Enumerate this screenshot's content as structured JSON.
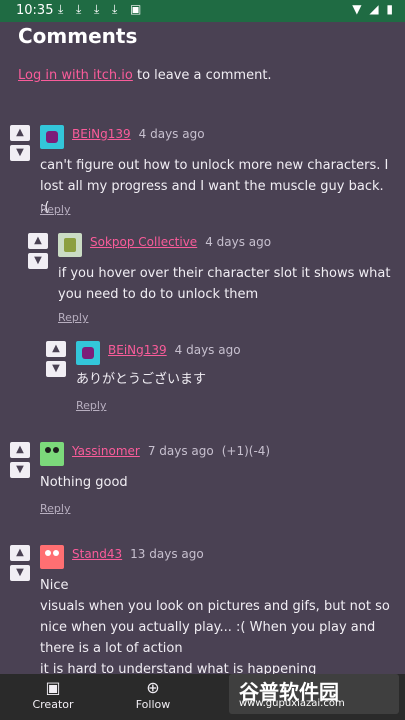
{
  "status": {
    "time": "10:35",
    "icons": [
      "download-icon",
      "download-icon",
      "download-icon",
      "download-icon",
      "a-icon"
    ],
    "right_icons": [
      "wifi-icon",
      "signal-icon",
      "battery-icon"
    ]
  },
  "page": {
    "title": "Comments",
    "login_link": "Log in with itch.io",
    "login_rest": " to leave a comment."
  },
  "comments": [
    {
      "author": "BEiNg139",
      "time": "4 days ago",
      "score": "",
      "body": "can't figure out how to unlock more new characters. I lost all my progress and I want the muscle guy back. :(",
      "reply": "Reply"
    },
    {
      "author": "Sokpop Collective",
      "time": "4 days ago",
      "score": "",
      "body": "if you hover over their character slot it shows what you need to do to unlock them",
      "reply": "Reply"
    },
    {
      "author": "BEiNg139",
      "time": "4 days ago",
      "score": "",
      "body": "ありがとうございます",
      "reply": "Reply"
    },
    {
      "author": "Yassinomer",
      "time": "7 days ago",
      "score": "(+1)(-4)",
      "body": "Nothing good",
      "reply": "Reply"
    },
    {
      "author": "Stand43",
      "time": "13 days ago",
      "score": "",
      "body": "Nice\nvisuals when you look on pictures and gifs, but not so nice when you actually play... :( When you play and there is a lot of action\nit is hard to understand what is happening"
    }
  ],
  "nav": {
    "creator": "Creator",
    "follow": "Follow"
  },
  "watermark": {
    "title": "谷普软件园",
    "url": "www.gupuxiazai.com"
  }
}
